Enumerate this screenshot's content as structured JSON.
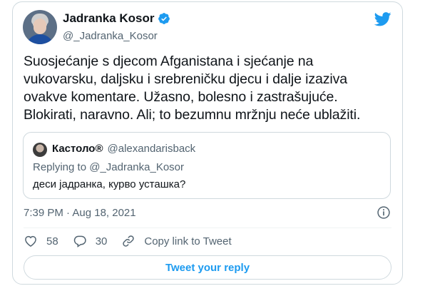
{
  "tweet": {
    "author": {
      "display_name": "Jadranka Kosor",
      "handle": "@_Jadranka_Kosor",
      "verified": true
    },
    "text_lines": [
      "Suosjećanje s djecom Afganistana i sjećanje na",
      "vukovarsku, daljsku i srebreničku djecu i dalje izaziva",
      "ovakve komentare. Užasno, bolesno i zastrašujuće.",
      "Blokirati, naravno. Ali; to bezumnu mržnju neće ublažiti."
    ],
    "quoted": {
      "display_name": "Кастоло",
      "name_badge": "®",
      "handle": "@alexandarisback",
      "replying_to": "Replying to @_Jadranka_Kosor",
      "text": "деси јадранка, курво усташка?"
    },
    "timestamp": "7:39 PM · Aug 18, 2021",
    "likes": "58",
    "replies": "30",
    "copy_link_label": "Copy link to Tweet",
    "reply_button_label": "Tweet your reply"
  },
  "colors": {
    "brand": "#1d9bf0",
    "text": "#0f1419",
    "muted": "#536471",
    "border": "#cfd9de"
  },
  "icons": [
    "verified-badge-icon",
    "twitter-bird-icon",
    "info-icon",
    "heart-icon",
    "reply-bubble-icon",
    "link-icon"
  ]
}
